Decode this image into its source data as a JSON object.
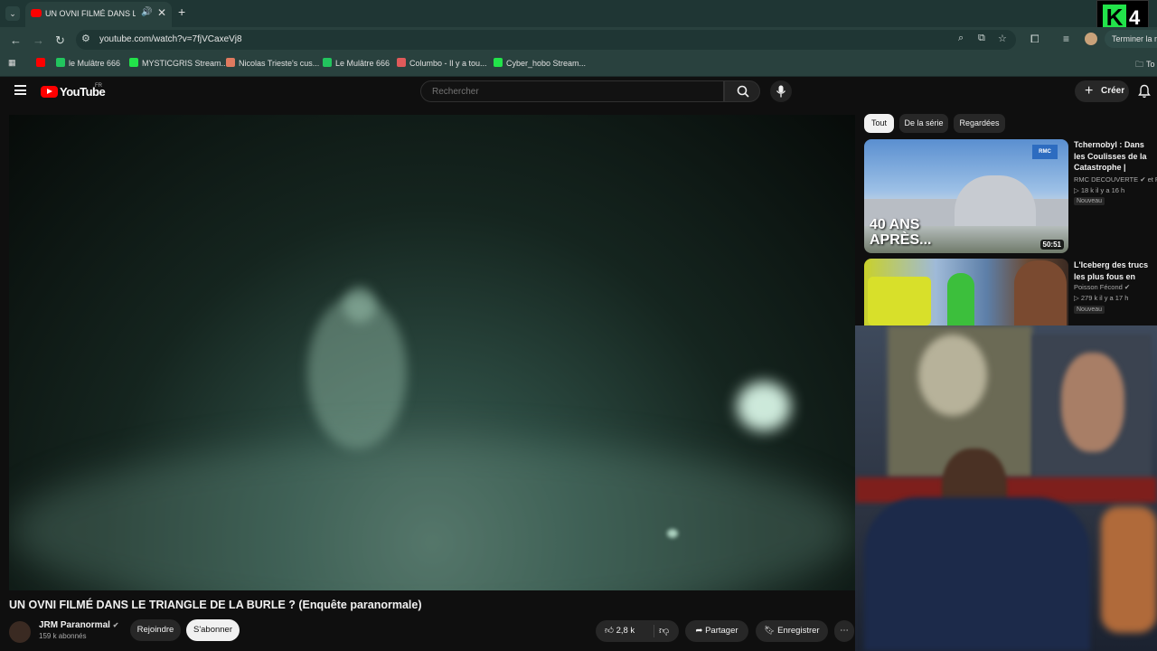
{
  "browser": {
    "tab_title": "UN OVNI FILMÉ DANS LE TRIANGLE DE LA BURLE ? (Enquête paranormale) - YouTube",
    "url": "youtube.com/watch?v=7fjVCaxeVj8",
    "end_session_label": "Terminer la m",
    "bookmarks": [
      {
        "label": "le Mulâtre 666",
        "color": "#22c55e"
      },
      {
        "label": "MYSTICGRIS Stream...",
        "color": "#22e34a"
      },
      {
        "label": "Nicolas Trieste's cus...",
        "color": "#e07a5f"
      },
      {
        "label": "Le Mulâtre 666",
        "color": "#22c55e"
      },
      {
        "label": "Columbo - Il y a tou...",
        "color": "#e05a5a"
      },
      {
        "label": "Cyber_hobo Stream...",
        "color": "#22e34a"
      }
    ],
    "bookmark_folder": "To"
  },
  "overlay": {
    "logo_letter": "K",
    "logo_number": "4"
  },
  "youtube": {
    "logo_text": "YouTube",
    "region": "FR",
    "search_placeholder": "Rechercher",
    "create_label": "Créer"
  },
  "video": {
    "title": "UN OVNI FILMÉ DANS LE TRIANGLE DE LA BURLE ? (Enquête paranormale)",
    "channel": "JRM Paranormal",
    "subscribers": "159 k abonnés",
    "join_label": "Rejoindre",
    "subscribe_label": "S'abonner",
    "likes": "2,8 k",
    "share_label": "Partager",
    "save_label": "Enregistrer"
  },
  "sidebar": {
    "chips": [
      "Tout",
      "De la série",
      "Regardées"
    ],
    "videos": [
      {
        "title": "Tchernobyl : Dans les Coulisses de la Catastrophe | Documentaire Complet",
        "channel": "RMC DECOUVERTE ✔ et RMC",
        "meta": "▷ 18 k  il y a 16 h",
        "badge": "Nouveau",
        "thumb_text_1": "40 ANS",
        "thumb_text_2": "APRÈS...",
        "thumb_logo": "RMC",
        "duration": "50:51"
      },
      {
        "title": "L'Iceberg des trucs les plus fous en Russie !",
        "channel": "Poisson Fécond ✔",
        "meta": "▷ 279 k  il y a 17 h",
        "badge": "Nouveau",
        "duration": ""
      }
    ]
  },
  "colors": {
    "youtube_red": "#ff0000",
    "browser_frame": "#29413e",
    "night_vision": "#4d6b60"
  }
}
